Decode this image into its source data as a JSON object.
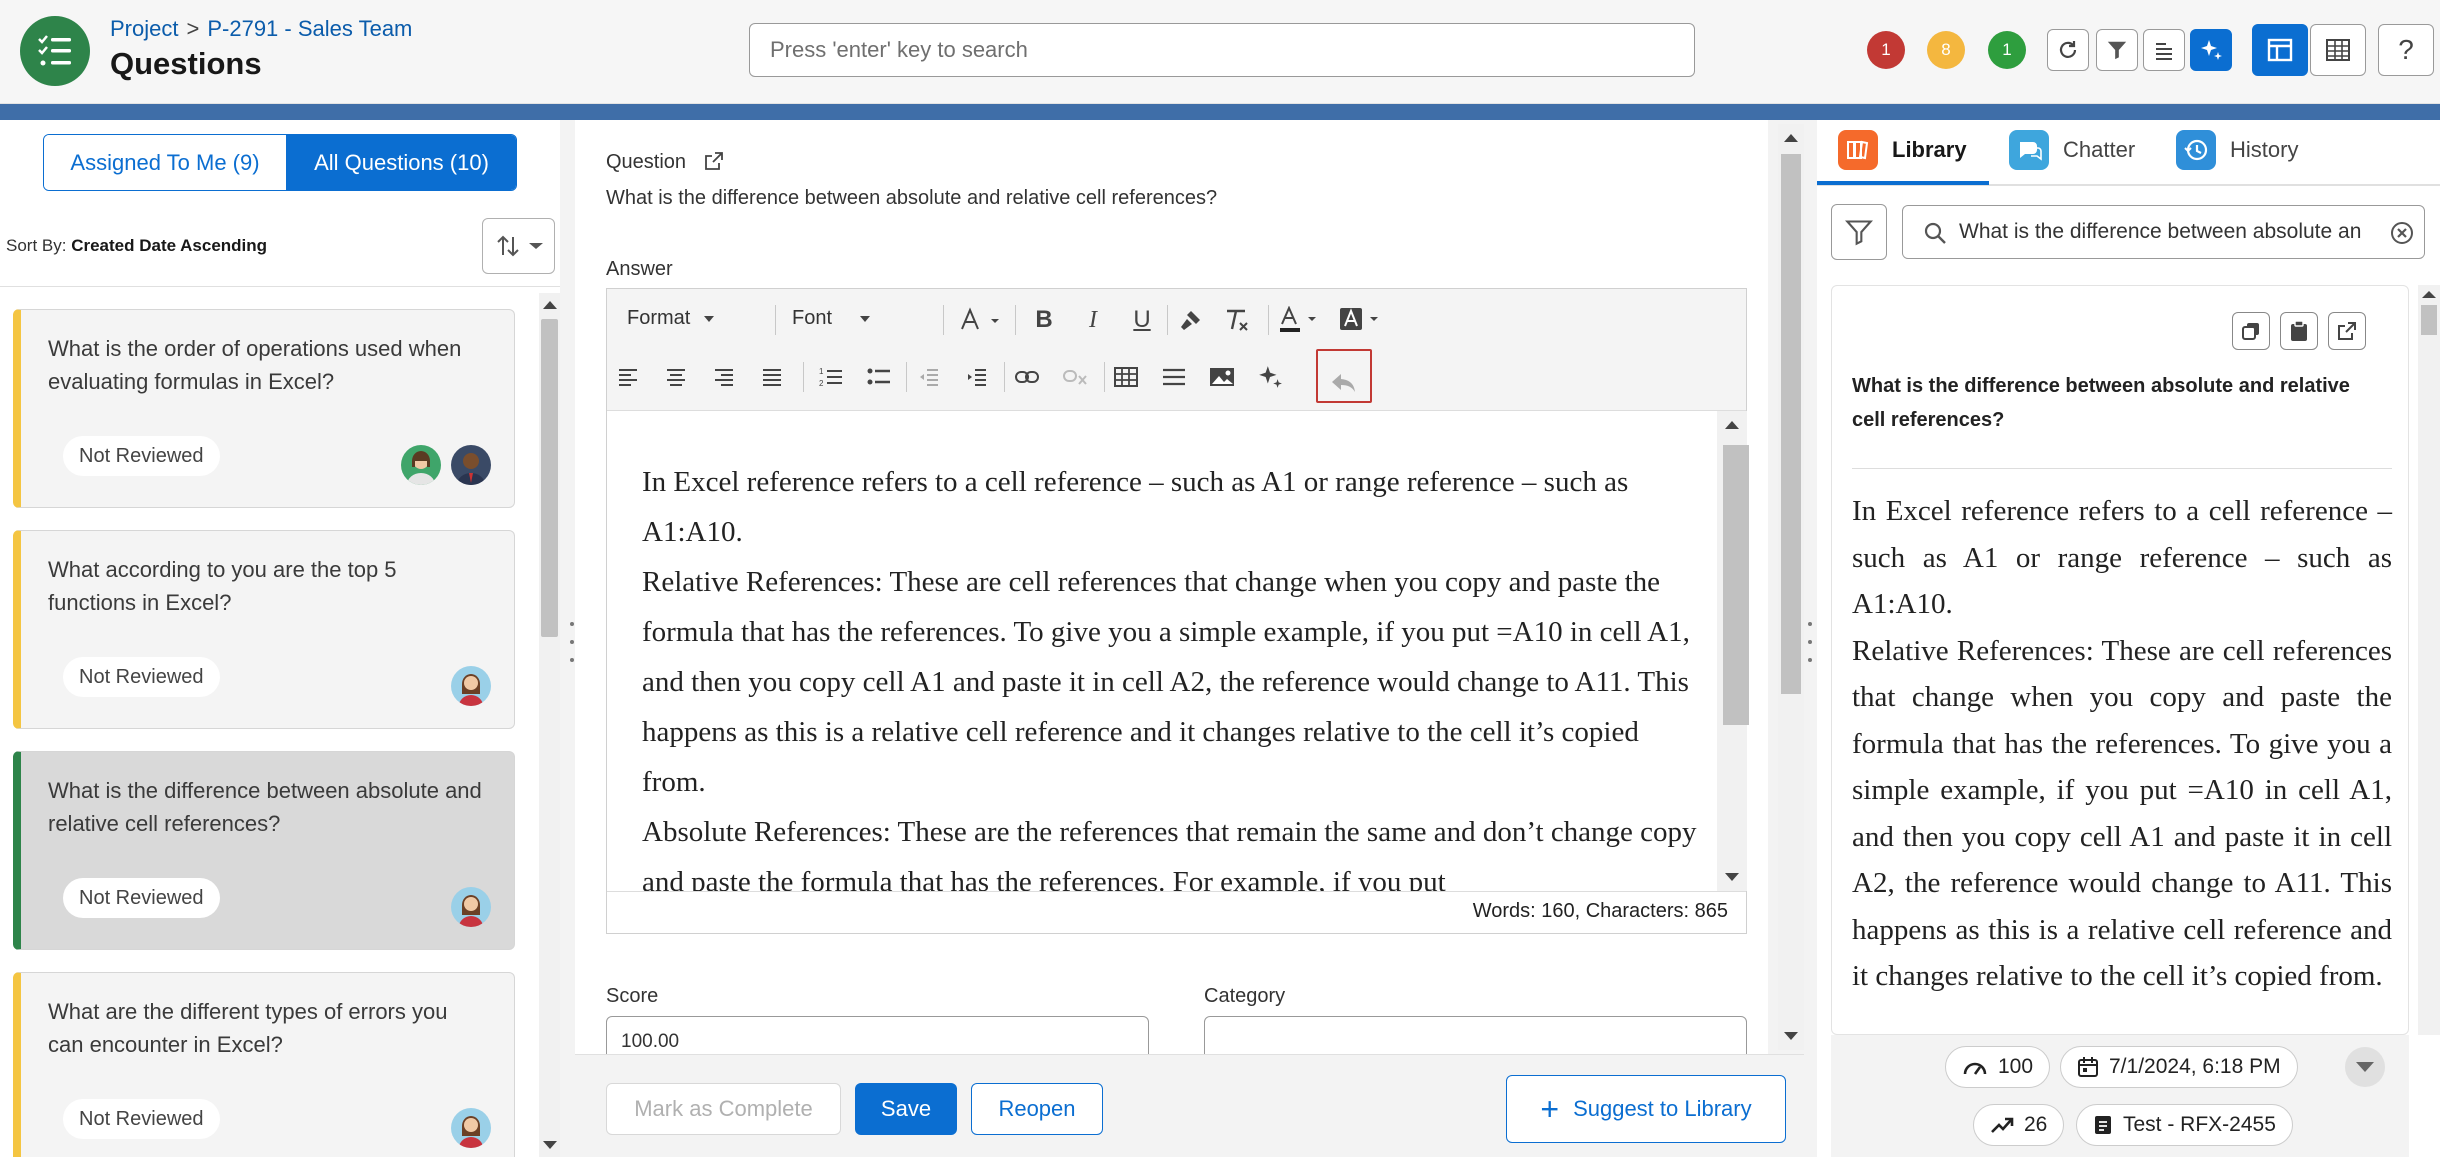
{
  "header": {
    "breadcrumb_root": "Project",
    "breadcrumb_sep": ">",
    "breadcrumb_project": "P-2791 - Sales Team",
    "title": "Questions",
    "search_placeholder": "Press 'enter' key to search",
    "status_counts": [
      {
        "value": "1",
        "color": "#c23934"
      },
      {
        "value": "8",
        "color": "#f4b73f"
      },
      {
        "value": "1",
        "color": "#2e9e3e"
      }
    ]
  },
  "left": {
    "tab_assigned": "Assigned To Me (9)",
    "tab_all": "All Questions (10)",
    "sort_prefix": "Sort By: ",
    "sort_value": "Created Date Ascending",
    "cards": [
      {
        "text": "What is the order of operations used when evaluating formulas in Excel?",
        "status": "Not Reviewed"
      },
      {
        "text": "What according to you are the top 5 functions in Excel?",
        "status": "Not Reviewed"
      },
      {
        "text": "What is the difference between absolute and relative cell references?",
        "status": "Not Reviewed"
      },
      {
        "text": "What are the different types of errors you can encounter in Excel?",
        "status": "Not Reviewed"
      }
    ]
  },
  "center": {
    "question_label": "Question",
    "question_text": "What is the difference between absolute and relative cell references?",
    "answer_label": "Answer",
    "format_select": "Format",
    "font_select": "Font",
    "answer_text": "In Excel reference refers to a cell reference – such as A1 or range reference – such as A1:A10.\nRelative References: These are cell references that change when you copy and paste the formula that has the references. To give you a simple example, if you put =A10 in cell A1, and then you copy cell A1 and paste it in cell A2, the reference would change to A11. This happens as this is a relative cell reference and it changes relative to the cell it’s copied from.\nAbsolute References: These are the references that remain the same and don’t change copy and paste the formula that has the references. For example, if you put",
    "word_count": "Words: 160, Characters: 865",
    "score_label": "Score",
    "score_value": "100.00",
    "category_label": "Category",
    "btn_complete": "Mark as Complete",
    "btn_save": "Save",
    "btn_reopen": "Reopen",
    "btn_suggest": "Suggest to Library"
  },
  "right": {
    "tab_library": "Library",
    "tab_chatter": "Chatter",
    "tab_history": "History",
    "search_value": "What is the difference between absolute an",
    "lib_question": "What is the difference between absolute and relative cell references?",
    "lib_answer": "In Excel reference refers to a cell reference – such as A1 or range reference – such as A1:A10.\nRelative References: These are cell references that change when you copy and paste the formula that has the references. To give you a simple example, if you put =A10 in cell A1, and then you copy cell A1 and paste it in cell A2, the reference would change to A11. This happens as this is a relative cell reference and it changes relative to the cell it’s copied from.",
    "chip_score": "100",
    "chip_date": "7/1/2024, 6:18 PM",
    "chip_uses": "26",
    "chip_source": "Test - RFX-2455"
  }
}
